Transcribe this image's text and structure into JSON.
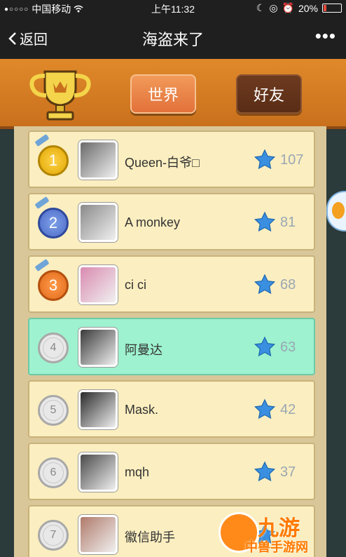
{
  "status_bar": {
    "carrier": "中国移动",
    "time": "上午11:32",
    "battery": "20%",
    "battery_level": 0.2
  },
  "nav": {
    "back_label": "返回",
    "title": "海盗来了",
    "more": "•••"
  },
  "tabs": {
    "world": "世界",
    "friends": "好友"
  },
  "leaderboard": [
    {
      "rank": "1",
      "name": "Queen-白爷□",
      "score": "107",
      "medal": "gold"
    },
    {
      "rank": "2",
      "name": "A monkey",
      "score": "81",
      "medal": "silver"
    },
    {
      "rank": "3",
      "name": "ci ci",
      "score": "68",
      "medal": "bronze"
    },
    {
      "rank": "4",
      "name": "阿曼达",
      "score": "63",
      "medal": "plain",
      "highlighted": true
    },
    {
      "rank": "5",
      "name": "Mask.",
      "score": "42",
      "medal": "plain"
    },
    {
      "rank": "6",
      "name": "mqh",
      "score": "37",
      "medal": "plain"
    },
    {
      "rank": "7",
      "name": "徽信助手",
      "score": "",
      "medal": "plain"
    }
  ],
  "watermark": {
    "big": "九游",
    "small": "中兽手游网"
  },
  "colors": {
    "header": "#d9822a",
    "row": "#fbeec0",
    "highlight": "#9ef2cf",
    "star": "#3b8fe0"
  }
}
